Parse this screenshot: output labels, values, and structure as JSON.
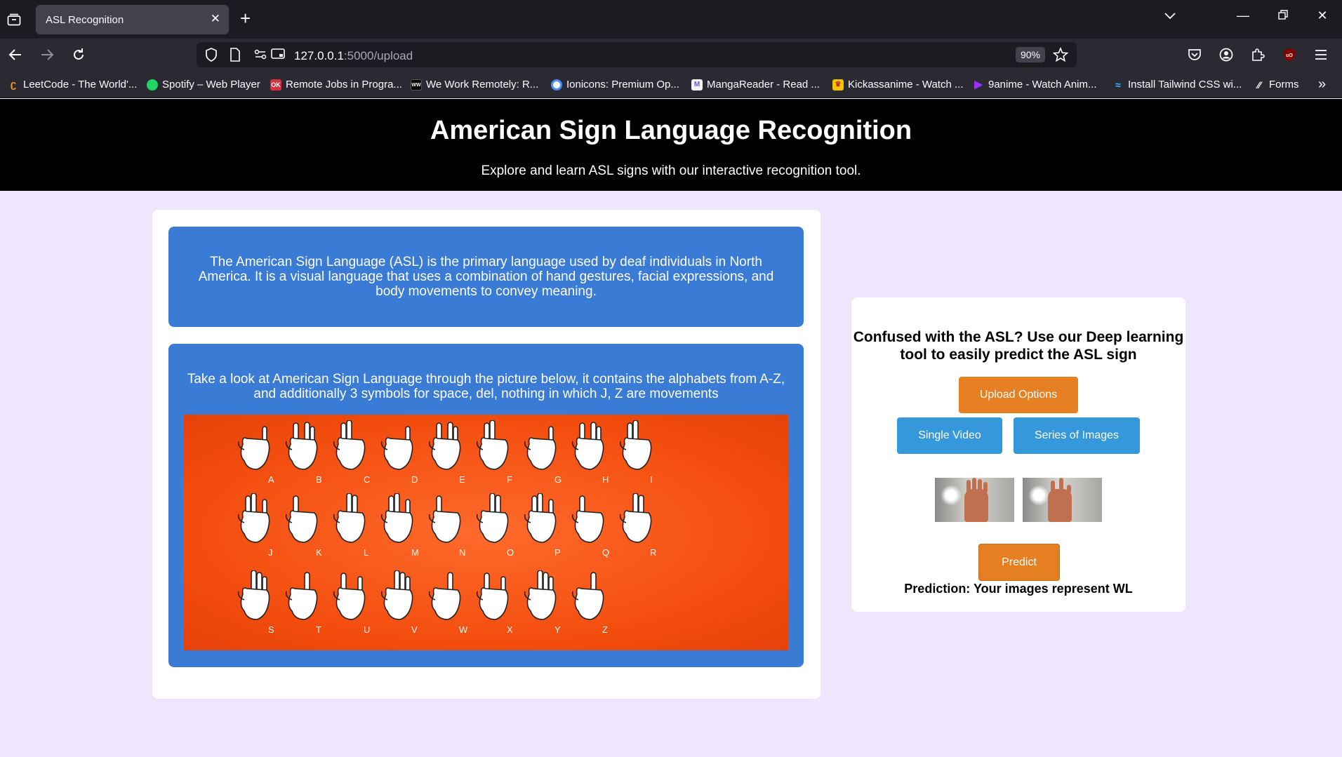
{
  "browser": {
    "tab_title": "ASL Recognition",
    "url_host": "127.0.0.1",
    "url_path": ":5000/upload",
    "zoom": "90%",
    "bookmarks": [
      {
        "label": "LeetCode - The World'...",
        "color": "#f89f1b",
        "icon": "leetcode-icon"
      },
      {
        "label": "Spotify – Web Player",
        "color": "#1ed760",
        "icon": "spotify-icon"
      },
      {
        "label": "Remote Jobs in Progra...",
        "color": "#d9303e",
        "icon": "remoteok-icon"
      },
      {
        "label": "We Work Remotely: R...",
        "color": "#000000",
        "icon": "weworkremotely-icon"
      },
      {
        "label": "Ionicons: Premium Op...",
        "color": "#4d8dff",
        "icon": "ionicons-icon"
      },
      {
        "label": "MangaReader - Read ...",
        "color": "#7b4fd6",
        "icon": "mangareader-icon"
      },
      {
        "label": "Kickassanime - Watch ...",
        "color": "#f5c400",
        "icon": "kickassanime-icon"
      },
      {
        "label": "9anime - Watch Anim...",
        "color": "#9b30ff",
        "icon": "9anime-icon"
      },
      {
        "label": "Install Tailwind CSS wi...",
        "color": "#38bdf8",
        "icon": "tailwind-icon"
      },
      {
        "label": "Forms",
        "color": "#ffffff",
        "icon": "forms-icon"
      }
    ]
  },
  "header": {
    "title": "American Sign Language Recognition",
    "subtitle": "Explore and learn ASL signs with our interactive recognition tool."
  },
  "info": {
    "paragraph1": "The American Sign Language (ASL) is the primary language used by deaf individuals in North America. It is a visual language that uses a combination of hand gestures, facial expressions, and body movements to convey meaning.",
    "paragraph2": "Take a look at American Sign Language through the picture below, it contains the alphabets from A-Z, and additionally 3 symbols for space, del, nothing in which J, Z are movements",
    "chart_rows": [
      [
        "A",
        "B",
        "C",
        "D",
        "E",
        "F",
        "G",
        "H",
        "I"
      ],
      [
        "J",
        "K",
        "L",
        "M",
        "N",
        "O",
        "P",
        "Q",
        "R"
      ],
      [
        "S",
        "T",
        "U",
        "V",
        "W",
        "X",
        "Y",
        "Z"
      ]
    ]
  },
  "tool": {
    "heading": "Confused with the ASL? Use our Deep learning tool to easily predict the ASL sign",
    "upload_options": "Upload Options",
    "single_video": "Single Video",
    "series_of_images": "Series of Images",
    "predict": "Predict",
    "prediction": "Prediction: Your images represent WL"
  },
  "colors": {
    "accent_orange": "#e67e22",
    "accent_blue": "#3498db",
    "info_blue": "#3a7bd5",
    "page_bg": "#efe6fd",
    "chart_orange": "#f24c0d"
  }
}
